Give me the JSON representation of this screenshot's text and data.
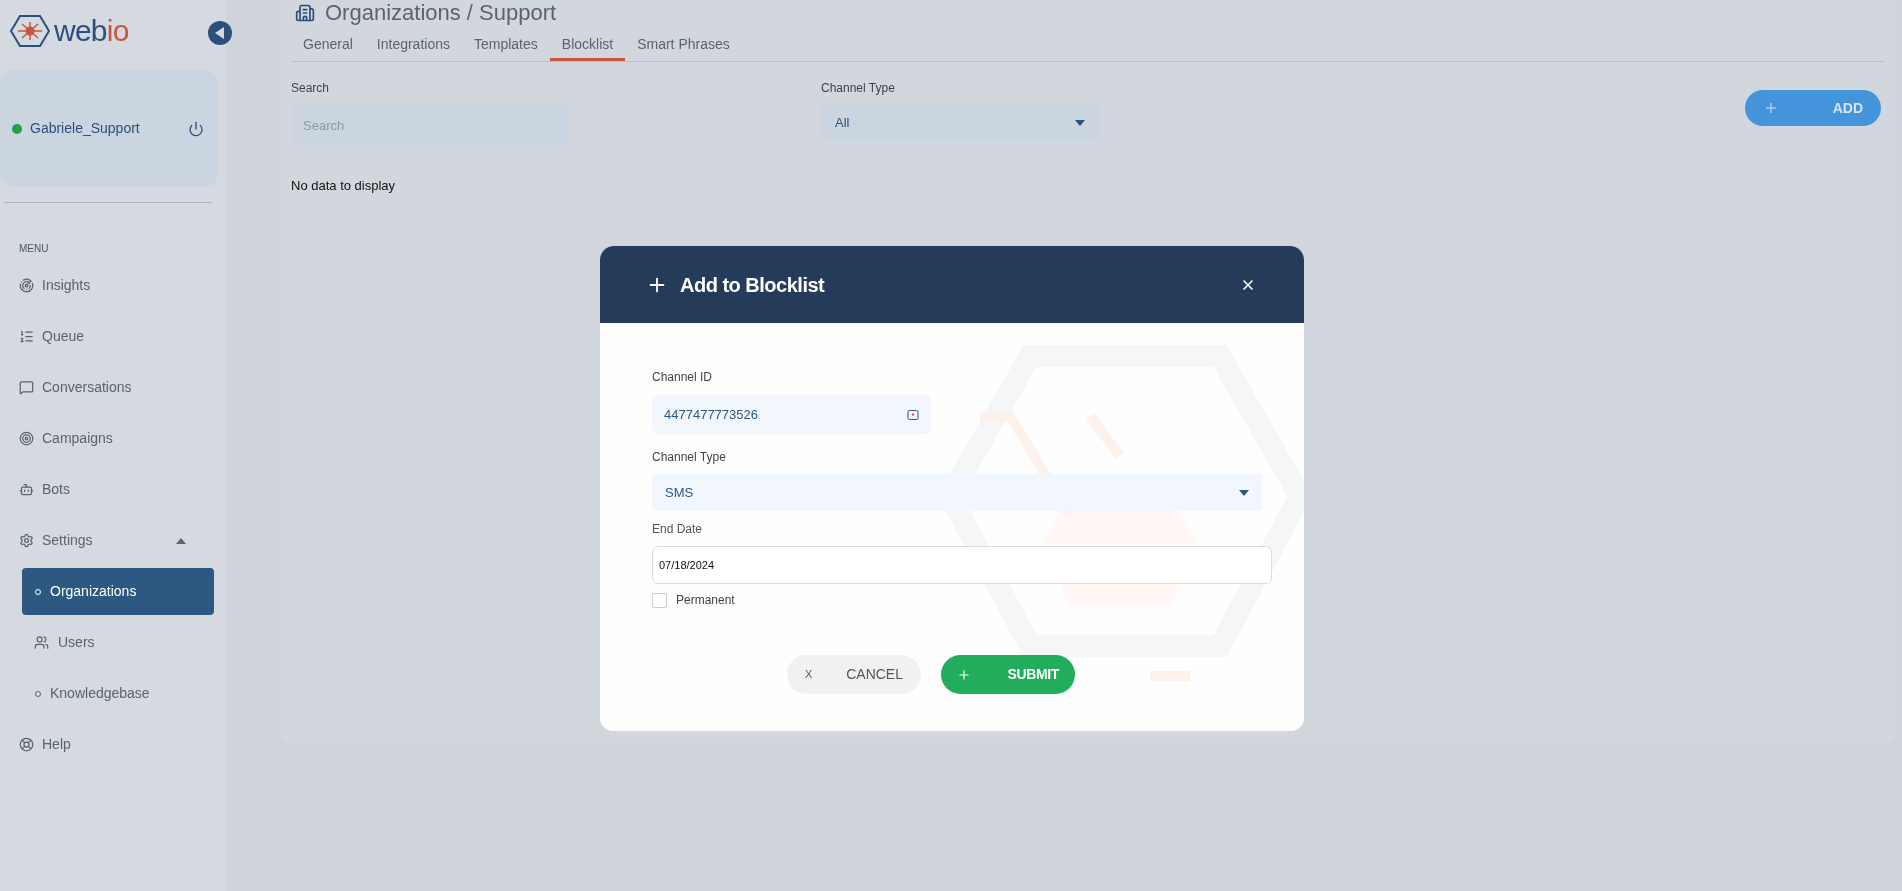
{
  "logo": [
    {
      "text": "web",
      "color": "#2d4f7c"
    },
    {
      "text": "io",
      "color": "#c8553d"
    }
  ],
  "user": {
    "name": "Gabriele_Support",
    "online": true
  },
  "menu_label": "MENU",
  "menu": [
    {
      "label": "Insights",
      "kind": "item"
    },
    {
      "label": "Queue",
      "kind": "item"
    },
    {
      "label": "Conversations",
      "kind": "item"
    },
    {
      "label": "Campaigns",
      "kind": "item"
    },
    {
      "label": "Bots",
      "kind": "item"
    },
    {
      "label": "Settings",
      "kind": "group",
      "expanded": true,
      "children": [
        {
          "label": "Organizations",
          "selected": true,
          "kind": "dot"
        },
        {
          "label": "Users",
          "selected": false,
          "kind": "users"
        },
        {
          "label": "Knowledgebase",
          "selected": false,
          "kind": "dot"
        }
      ]
    },
    {
      "label": "Help",
      "kind": "item"
    }
  ],
  "page": {
    "title": "Organizations / Support",
    "tabs": [
      {
        "label": "General",
        "selected": false
      },
      {
        "label": "Integrations",
        "selected": false
      },
      {
        "label": "Templates",
        "selected": false
      },
      {
        "label": "Blocklist",
        "selected": true
      },
      {
        "label": "Smart Phrases",
        "selected": false
      }
    ],
    "search": {
      "label": "Search",
      "placeholder": "Search"
    },
    "channel_type": {
      "label": "Channel Type",
      "value": "All"
    },
    "add_button": "ADD",
    "empty_text": "No data to display"
  },
  "modal": {
    "title": "Add to Blocklist",
    "channel_id": {
      "label": "Channel ID",
      "value": "4477477773526"
    },
    "channel_type": {
      "label": "Channel Type",
      "value": "SMS"
    },
    "end_date": {
      "label": "End Date",
      "value": "07/18/2024"
    },
    "permanent": {
      "label": "Permanent",
      "checked": false
    },
    "cancel": {
      "icon": "X",
      "label": "CANCEL"
    },
    "submit": "SUBMIT"
  }
}
